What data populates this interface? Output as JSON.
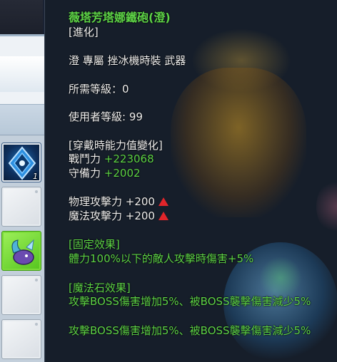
{
  "item": {
    "name": "薇塔芳塔娜鐵砲(澄)",
    "upgrade_tag": "[進化]",
    "type_line": "澄 專屬 挫冰機時裝 武器",
    "req_level_label": "所需等級：0",
    "user_level_label": "使用者等級: 99"
  },
  "stat_change": {
    "header": "[穿戴時能力值變化]",
    "attack_label": "戰鬥力",
    "attack_value": "+223068",
    "defense_label": "守備力",
    "defense_value": "+2002"
  },
  "attack_stats": [
    {
      "label": "物理攻擊力 +200",
      "arrow_icon": "up-triangle-icon"
    },
    {
      "label": "魔法攻擊力 +200",
      "arrow_icon": "up-triangle-icon"
    }
  ],
  "fixed_effect": {
    "header": "[固定效果]",
    "text": "體力100%以下的敵人攻擊時傷害+5%"
  },
  "magic_stone": {
    "header": "[魔法石效果]",
    "effect_1": "攻擊BOSS傷害增加5%、被BOSS襲擊傷害減少5%",
    "effect_2": "攻擊BOSS傷害增加5%、被BOSS襲擊傷害減少5%"
  },
  "inventory": {
    "slots": [
      {
        "icon": "blue-crystal-gem-icon",
        "count": "1"
      },
      {
        "icon": "empty-slot"
      },
      {
        "icon": "green-creature-icon"
      },
      {
        "icon": "empty-slot"
      },
      {
        "icon": "empty-slot"
      }
    ]
  },
  "colors": {
    "title_green": "#5ed447",
    "text_white": "#f0f0f0",
    "arrow_red": "#e1252a",
    "panel_bg": "#161e28"
  }
}
